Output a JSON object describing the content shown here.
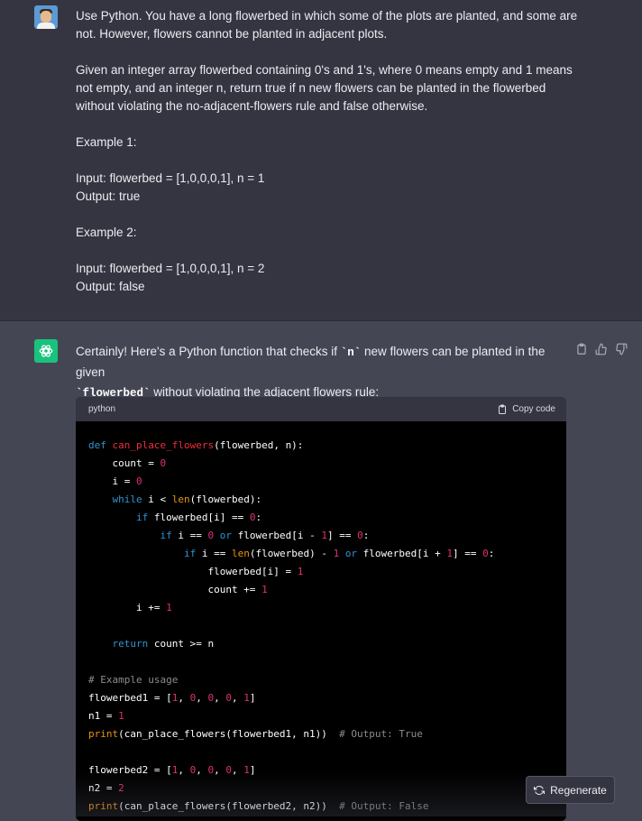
{
  "user_message": {
    "paragraphs": [
      "Use Python. You have a long flowerbed in which some of the plots are planted, and some are not. However, flowers cannot be planted in adjacent plots.",
      "Given an integer array flowerbed containing 0's and 1's, where 0 means empty and 1 means not empty, and an integer n, return true if n new flowers can be planted in the flowerbed without violating the no-adjacent-flowers rule and false otherwise.",
      "Example 1:",
      "Input: flowerbed = [1,0,0,0,1], n = 1\nOutput: true",
      "Example 2:",
      "Input: flowerbed = [1,0,0,0,1], n = 2\nOutput: false"
    ]
  },
  "assistant_message": {
    "intro_before_n": "Certainly! Here's a Python function that checks if ",
    "n_code": "`n`",
    "intro_after_n": " new flowers can be planted in the given",
    "flowerbed_code": "`flowerbed`",
    "intro_end": " without violating the adjacent flowers rule:"
  },
  "code_block": {
    "language": "python",
    "copy_label": "Copy code",
    "lines": [
      [
        {
          "t": "def",
          "c": "kw"
        },
        {
          "t": " "
        },
        {
          "t": "can_place_flowers",
          "c": "fn"
        },
        {
          "t": "(flowerbed, n):"
        }
      ],
      [
        {
          "t": "    count = "
        },
        {
          "t": "0",
          "c": "num"
        }
      ],
      [
        {
          "t": "    i = "
        },
        {
          "t": "0",
          "c": "num"
        }
      ],
      [
        {
          "t": "    "
        },
        {
          "t": "while",
          "c": "kw"
        },
        {
          "t": " i < "
        },
        {
          "t": "len",
          "c": "bi"
        },
        {
          "t": "(flowerbed):"
        }
      ],
      [
        {
          "t": "        "
        },
        {
          "t": "if",
          "c": "kw"
        },
        {
          "t": " flowerbed[i] == "
        },
        {
          "t": "0",
          "c": "num"
        },
        {
          "t": ":"
        }
      ],
      [
        {
          "t": "            "
        },
        {
          "t": "if",
          "c": "kw"
        },
        {
          "t": " i == "
        },
        {
          "t": "0",
          "c": "num"
        },
        {
          "t": " "
        },
        {
          "t": "or",
          "c": "kw"
        },
        {
          "t": " flowerbed[i - "
        },
        {
          "t": "1",
          "c": "num"
        },
        {
          "t": "] == "
        },
        {
          "t": "0",
          "c": "num"
        },
        {
          "t": ":"
        }
      ],
      [
        {
          "t": "                "
        },
        {
          "t": "if",
          "c": "kw"
        },
        {
          "t": " i == "
        },
        {
          "t": "len",
          "c": "bi"
        },
        {
          "t": "(flowerbed) - "
        },
        {
          "t": "1",
          "c": "num"
        },
        {
          "t": " "
        },
        {
          "t": "or",
          "c": "kw"
        },
        {
          "t": " flowerbed[i + "
        },
        {
          "t": "1",
          "c": "num"
        },
        {
          "t": "] == "
        },
        {
          "t": "0",
          "c": "num"
        },
        {
          "t": ":"
        }
      ],
      [
        {
          "t": "                    flowerbed[i] = "
        },
        {
          "t": "1",
          "c": "num"
        }
      ],
      [
        {
          "t": "                    count += "
        },
        {
          "t": "1",
          "c": "num"
        }
      ],
      [
        {
          "t": "        i += "
        },
        {
          "t": "1",
          "c": "num"
        }
      ],
      [],
      [
        {
          "t": "    "
        },
        {
          "t": "return",
          "c": "kw"
        },
        {
          "t": " count >= n"
        }
      ],
      [],
      [
        {
          "t": "# Example usage",
          "c": "cm"
        }
      ],
      [
        {
          "t": "flowerbed1 = ["
        },
        {
          "t": "1",
          "c": "num"
        },
        {
          "t": ", "
        },
        {
          "t": "0",
          "c": "num"
        },
        {
          "t": ", "
        },
        {
          "t": "0",
          "c": "num"
        },
        {
          "t": ", "
        },
        {
          "t": "0",
          "c": "num"
        },
        {
          "t": ", "
        },
        {
          "t": "1",
          "c": "num"
        },
        {
          "t": "]"
        }
      ],
      [
        {
          "t": "n1 = "
        },
        {
          "t": "1",
          "c": "num"
        }
      ],
      [
        {
          "t": "print",
          "c": "bi"
        },
        {
          "t": "(can_place_flowers(flowerbed1, n1))  "
        },
        {
          "t": "# Output: True",
          "c": "cm"
        }
      ],
      [],
      [
        {
          "t": "flowerbed2 = ["
        },
        {
          "t": "1",
          "c": "num"
        },
        {
          "t": ", "
        },
        {
          "t": "0",
          "c": "num"
        },
        {
          "t": ", "
        },
        {
          "t": "0",
          "c": "num"
        },
        {
          "t": ", "
        },
        {
          "t": "0",
          "c": "num"
        },
        {
          "t": ", "
        },
        {
          "t": "1",
          "c": "num"
        },
        {
          "t": "]"
        }
      ],
      [
        {
          "t": "n2 = "
        },
        {
          "t": "2",
          "c": "num"
        }
      ],
      [
        {
          "t": "print",
          "c": "bi"
        },
        {
          "t": "(can_place_flowers(flowerbed2, n2))  "
        },
        {
          "t": "# Output: False",
          "c": "cm"
        }
      ]
    ]
  },
  "actions": {
    "copy_icon": "clipboard-icon",
    "like_icon": "thumbs-up-icon",
    "dislike_icon": "thumbs-down-icon"
  },
  "regenerate": {
    "label": "Regenerate",
    "icon": "refresh-icon"
  },
  "colors": {
    "user_bg": "#343541",
    "assistant_bg": "#444654",
    "code_bg": "#000000",
    "keyword": "#2e95d3",
    "function": "#f22c3d",
    "builtin": "#e9950c",
    "number": "#df3079",
    "comment": "#8c8c8c",
    "assistant_avatar": "#19c37d"
  }
}
